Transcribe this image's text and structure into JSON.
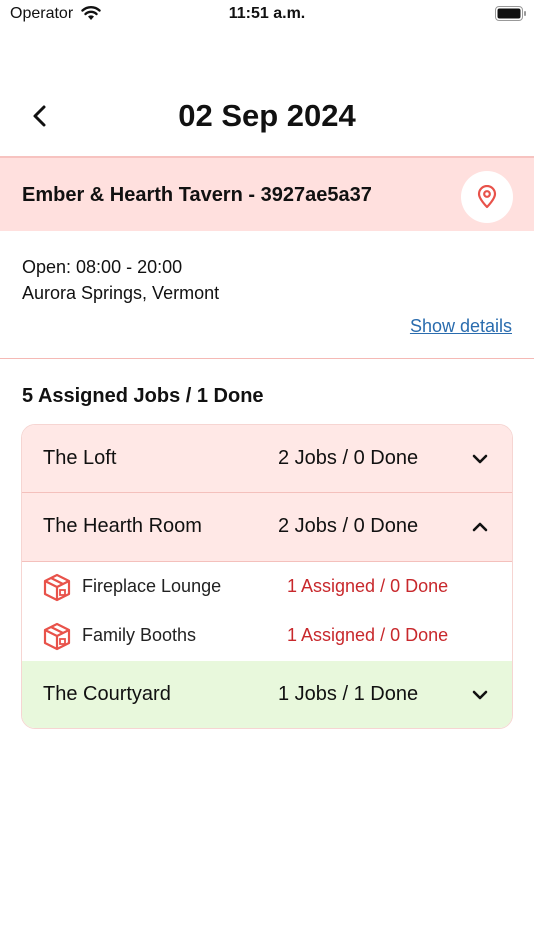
{
  "status_bar": {
    "carrier": "Operator",
    "time": "11:51 a.m."
  },
  "header": {
    "title": "02 Sep 2024",
    "back_icon": "chevron-left-icon"
  },
  "store": {
    "name": "Ember & Hearth Tavern - 3927ae5a37",
    "hours": "Open: 08:00 - 20:00",
    "location": "Aurora Springs, Vermont",
    "show_details": "Show details",
    "location_icon": "map-pin-icon"
  },
  "summary": "5 Assigned Jobs / 1 Done",
  "zones": [
    {
      "name": "The Loft",
      "count": "2 Jobs / 0 Done",
      "expanded": false
    },
    {
      "name": "The Hearth Room",
      "count": "2 Jobs / 0 Done",
      "expanded": true,
      "areas": [
        {
          "name": "Fireplace Lounge",
          "count": "1 Assigned / 0 Done",
          "icon": "box-icon"
        },
        {
          "name": "Family Booths",
          "count": "1 Assigned / 0 Done",
          "icon": "box-icon"
        }
      ]
    },
    {
      "name": "The Courtyard",
      "count": "1 Jobs / 1 Done",
      "expanded": false
    }
  ],
  "colors": {
    "accent_red": "#e8524a",
    "banner_pink": "#ffe0de",
    "zone_pink": "#ffe8e6",
    "zone_green": "#e8f8dc",
    "link_blue": "#2a6cae",
    "count_red": "#c8282c"
  }
}
